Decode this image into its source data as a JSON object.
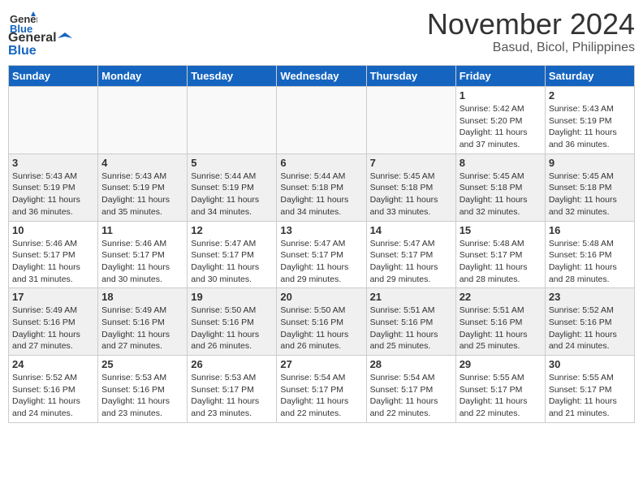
{
  "header": {
    "logo_line1": "General",
    "logo_line2": "Blue",
    "month": "November 2024",
    "location": "Basud, Bicol, Philippines"
  },
  "weekdays": [
    "Sunday",
    "Monday",
    "Tuesday",
    "Wednesday",
    "Thursday",
    "Friday",
    "Saturday"
  ],
  "weeks": [
    [
      {
        "day": null
      },
      {
        "day": null
      },
      {
        "day": null
      },
      {
        "day": null
      },
      {
        "day": null
      },
      {
        "day": 1,
        "sunrise": "5:42 AM",
        "sunset": "5:20 PM",
        "daylight": "11 hours and 37 minutes."
      },
      {
        "day": 2,
        "sunrise": "5:43 AM",
        "sunset": "5:19 PM",
        "daylight": "11 hours and 36 minutes."
      }
    ],
    [
      {
        "day": 3,
        "sunrise": "5:43 AM",
        "sunset": "5:19 PM",
        "daylight": "11 hours and 36 minutes."
      },
      {
        "day": 4,
        "sunrise": "5:43 AM",
        "sunset": "5:19 PM",
        "daylight": "11 hours and 35 minutes."
      },
      {
        "day": 5,
        "sunrise": "5:44 AM",
        "sunset": "5:19 PM",
        "daylight": "11 hours and 34 minutes."
      },
      {
        "day": 6,
        "sunrise": "5:44 AM",
        "sunset": "5:18 PM",
        "daylight": "11 hours and 34 minutes."
      },
      {
        "day": 7,
        "sunrise": "5:45 AM",
        "sunset": "5:18 PM",
        "daylight": "11 hours and 33 minutes."
      },
      {
        "day": 8,
        "sunrise": "5:45 AM",
        "sunset": "5:18 PM",
        "daylight": "11 hours and 32 minutes."
      },
      {
        "day": 9,
        "sunrise": "5:45 AM",
        "sunset": "5:18 PM",
        "daylight": "11 hours and 32 minutes."
      }
    ],
    [
      {
        "day": 10,
        "sunrise": "5:46 AM",
        "sunset": "5:17 PM",
        "daylight": "11 hours and 31 minutes."
      },
      {
        "day": 11,
        "sunrise": "5:46 AM",
        "sunset": "5:17 PM",
        "daylight": "11 hours and 30 minutes."
      },
      {
        "day": 12,
        "sunrise": "5:47 AM",
        "sunset": "5:17 PM",
        "daylight": "11 hours and 30 minutes."
      },
      {
        "day": 13,
        "sunrise": "5:47 AM",
        "sunset": "5:17 PM",
        "daylight": "11 hours and 29 minutes."
      },
      {
        "day": 14,
        "sunrise": "5:47 AM",
        "sunset": "5:17 PM",
        "daylight": "11 hours and 29 minutes."
      },
      {
        "day": 15,
        "sunrise": "5:48 AM",
        "sunset": "5:17 PM",
        "daylight": "11 hours and 28 minutes."
      },
      {
        "day": 16,
        "sunrise": "5:48 AM",
        "sunset": "5:16 PM",
        "daylight": "11 hours and 28 minutes."
      }
    ],
    [
      {
        "day": 17,
        "sunrise": "5:49 AM",
        "sunset": "5:16 PM",
        "daylight": "11 hours and 27 minutes."
      },
      {
        "day": 18,
        "sunrise": "5:49 AM",
        "sunset": "5:16 PM",
        "daylight": "11 hours and 27 minutes."
      },
      {
        "day": 19,
        "sunrise": "5:50 AM",
        "sunset": "5:16 PM",
        "daylight": "11 hours and 26 minutes."
      },
      {
        "day": 20,
        "sunrise": "5:50 AM",
        "sunset": "5:16 PM",
        "daylight": "11 hours and 26 minutes."
      },
      {
        "day": 21,
        "sunrise": "5:51 AM",
        "sunset": "5:16 PM",
        "daylight": "11 hours and 25 minutes."
      },
      {
        "day": 22,
        "sunrise": "5:51 AM",
        "sunset": "5:16 PM",
        "daylight": "11 hours and 25 minutes."
      },
      {
        "day": 23,
        "sunrise": "5:52 AM",
        "sunset": "5:16 PM",
        "daylight": "11 hours and 24 minutes."
      }
    ],
    [
      {
        "day": 24,
        "sunrise": "5:52 AM",
        "sunset": "5:16 PM",
        "daylight": "11 hours and 24 minutes."
      },
      {
        "day": 25,
        "sunrise": "5:53 AM",
        "sunset": "5:16 PM",
        "daylight": "11 hours and 23 minutes."
      },
      {
        "day": 26,
        "sunrise": "5:53 AM",
        "sunset": "5:17 PM",
        "daylight": "11 hours and 23 minutes."
      },
      {
        "day": 27,
        "sunrise": "5:54 AM",
        "sunset": "5:17 PM",
        "daylight": "11 hours and 22 minutes."
      },
      {
        "day": 28,
        "sunrise": "5:54 AM",
        "sunset": "5:17 PM",
        "daylight": "11 hours and 22 minutes."
      },
      {
        "day": 29,
        "sunrise": "5:55 AM",
        "sunset": "5:17 PM",
        "daylight": "11 hours and 22 minutes."
      },
      {
        "day": 30,
        "sunrise": "5:55 AM",
        "sunset": "5:17 PM",
        "daylight": "11 hours and 21 minutes."
      }
    ]
  ]
}
